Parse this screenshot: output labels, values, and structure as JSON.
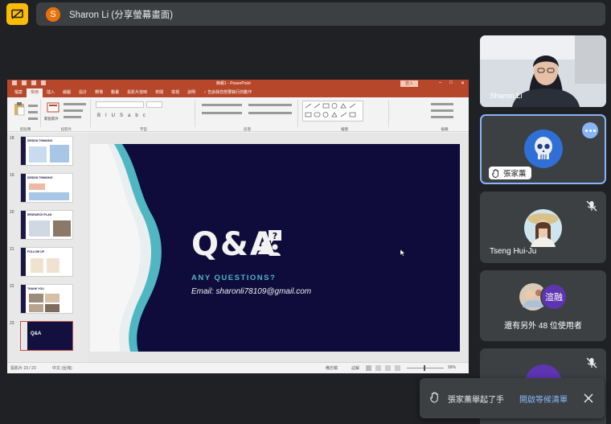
{
  "meeting": {
    "presenter_initial": "S",
    "title": "Sharon Li (分享螢幕畫面)"
  },
  "ppt": {
    "doc_title": "簡報1 - PowerPoint",
    "signin": "登入",
    "tabs": [
      "檔案",
      "常用",
      "插入",
      "繪圖",
      "設計",
      "轉場",
      "動畫",
      "投影片放映",
      "校閱",
      "檢視",
      "說明",
      "♀ 告訴我您想要執行的動作"
    ],
    "ribbon_groups": [
      "剪貼簿",
      "投影片",
      "字型",
      "段落",
      "繪圖",
      "編輯"
    ],
    "new_slide_label": "新投影片",
    "thumbnails": [
      {
        "num": "18",
        "title": "DESIGN THINKING"
      },
      {
        "num": "19",
        "title": "DESIGN THINKING"
      },
      {
        "num": "20",
        "title": "RESEARCH PLAN"
      },
      {
        "num": "21",
        "title": "FOLLOW UP"
      },
      {
        "num": "22",
        "title": "THANK YOU"
      },
      {
        "num": "23",
        "title": "Q&A"
      }
    ],
    "status_left": "投影片 23 / 23",
    "status_lang": "中文 (台灣)",
    "status_notes": "備忘稿",
    "status_comments": "註解",
    "status_zoom": "99%"
  },
  "slide": {
    "title": "Q&A",
    "subtitle": "ANY QUESTIONS?",
    "email": "Email: sharonli78109@gmail.com",
    "accent_color": "#4fb6c2",
    "background_color": "#0f0b3b"
  },
  "participants": [
    {
      "name": "Sharon Li"
    },
    {
      "name": "張家薰",
      "avatar_icon": "skull-icon"
    },
    {
      "name": "Tseng Hui-Ju"
    },
    {
      "name": "還有另外 48 位使用者",
      "second_initial": "渲融"
    }
  ],
  "toast": {
    "text": "張家薰舉起了手",
    "link": "開啟等候清單"
  }
}
